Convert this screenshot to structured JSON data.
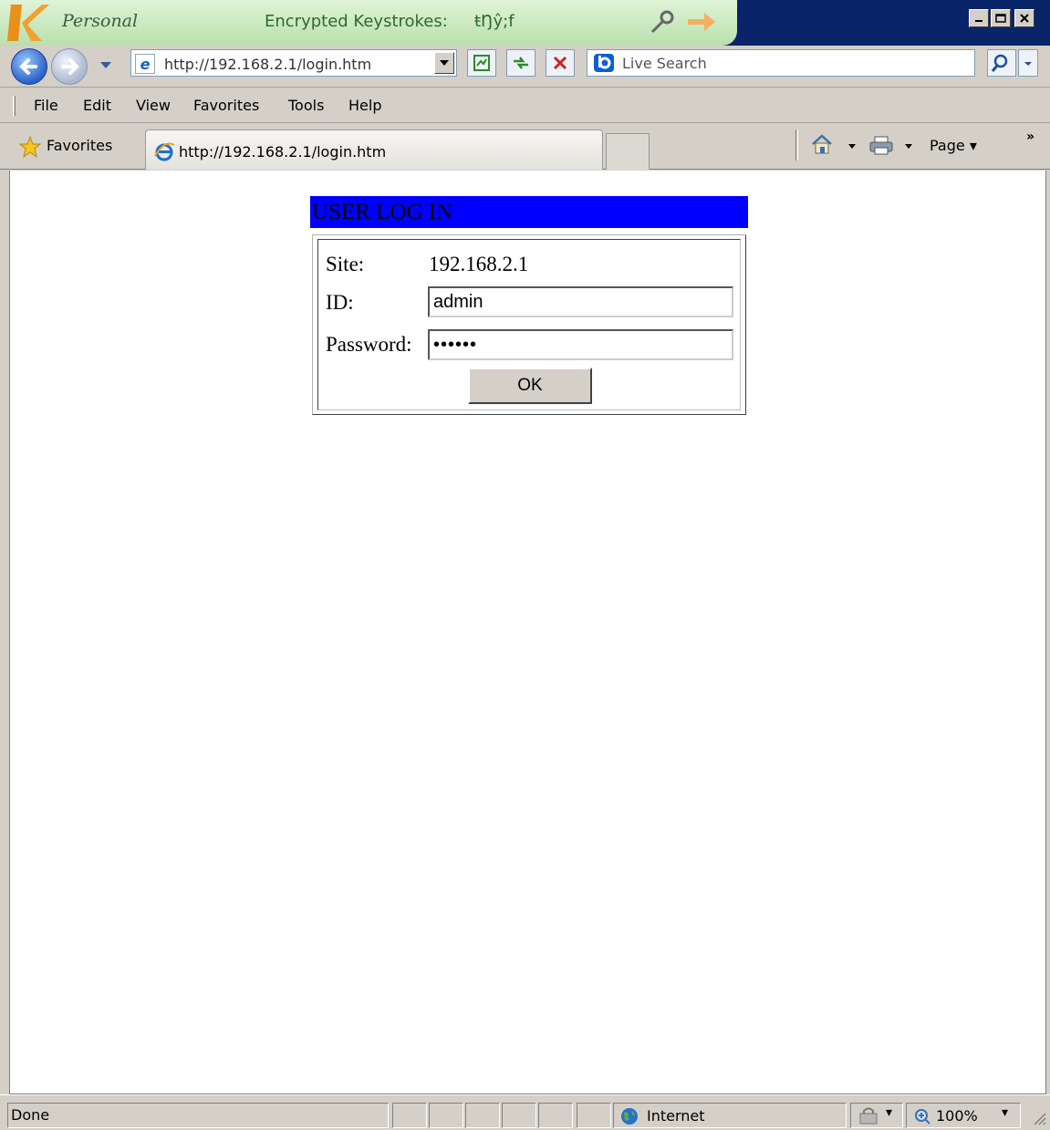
{
  "titlebar": {
    "app_name": "Personal",
    "encrypted_label": "Encrypted Keystrokes:",
    "encrypted_value": "ŧŊŷ;f"
  },
  "address": {
    "url": "http://192.168.2.1/login.htm",
    "search_placeholder": "Live Search"
  },
  "menu": [
    "File",
    "Edit",
    "View",
    "Favorites",
    "Tools",
    "Help"
  ],
  "favorites_bar": {
    "favorites_label": "Favorites",
    "tab_title": "http://192.168.2.1/login.htm",
    "page_menu": "Page"
  },
  "login": {
    "header": "USER LOG IN",
    "site_label": "Site:",
    "site_value": "192.168.2.1",
    "id_label": "ID:",
    "id_value": "admin",
    "password_label": "Password:",
    "password_value": "••••••",
    "ok_label": "OK"
  },
  "status": {
    "text": "Done",
    "zone": "Internet",
    "zoom": "100%"
  },
  "colors": {
    "titlebar": "#0a246a",
    "login_header": "#0000ff"
  }
}
